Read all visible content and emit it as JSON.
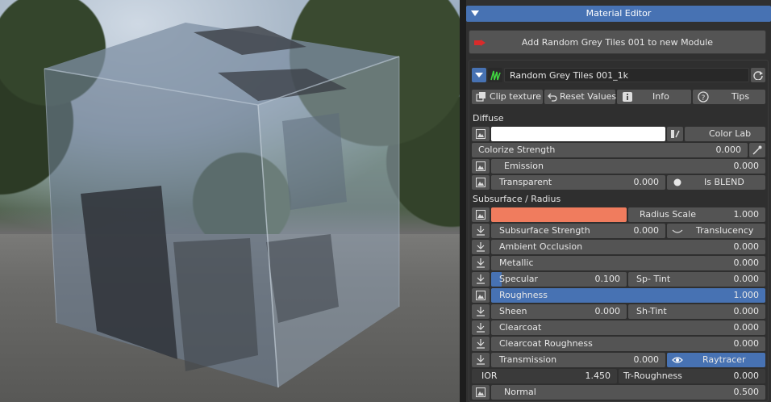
{
  "viewport": {
    "description_free": true
  },
  "panel": {
    "title": "Material Editor",
    "add_button": "Add Random Grey Tiles 001 to new Module",
    "material_name": "Random Grey Tiles 001_1k",
    "toolbar": {
      "clip_texture": "Clip texture",
      "reset_values": "Reset Values",
      "info": "Info",
      "tips": "Tips"
    },
    "diffuse": {
      "label": "Diffuse",
      "color_lab": "Color Lab",
      "colorize_strength_label": "Colorize Strength",
      "colorize_strength_value": "0.000",
      "emission_label": "Emission",
      "emission_value": "0.000",
      "transparent_label": "Transparent",
      "transparent_value": "0.000",
      "is_blend_label": "Is BLEND"
    },
    "subsurface": {
      "label": "Subsurface / Radius",
      "radius_scale_label": "Radius Scale",
      "radius_scale_value": "1.000",
      "subsurface_strength_label": "Subsurface Strength",
      "subsurface_strength_value": "0.000",
      "translucency_label": "Translucency",
      "ao_label": "Ambient Occlusion",
      "ao_value": "0.000",
      "metallic_label": "Metallic",
      "metallic_value": "0.000",
      "specular_label": "Specular",
      "specular_value": "0.100",
      "spec_tint_label": "Sp- Tint",
      "spec_tint_value": "0.000",
      "roughness_label": "Roughness",
      "roughness_value": "1.000",
      "sheen_label": "Sheen",
      "sheen_value": "0.000",
      "sheen_tint_label": "Sh-Tint",
      "sheen_tint_value": "0.000",
      "clearcoat_label": "Clearcoat",
      "clearcoat_value": "0.000",
      "clearcoat_roughness_label": "Clearcoat Roughness",
      "clearcoat_roughness_value": "0.000",
      "transmission_label": "Transmission",
      "transmission_value": "0.000",
      "raytracer_label": "Raytracer",
      "ior_label": "IOR",
      "ior_value": "1.450",
      "tr_roughness_label": "Tr-Roughness",
      "tr_roughness_value": "0.000",
      "normal_label": "Normal",
      "normal_value": "0.500"
    }
  },
  "colors": {
    "accent_blue": "#4772b3",
    "radius_color": "#f07c5e",
    "diffuse_color": "#ffffff"
  }
}
